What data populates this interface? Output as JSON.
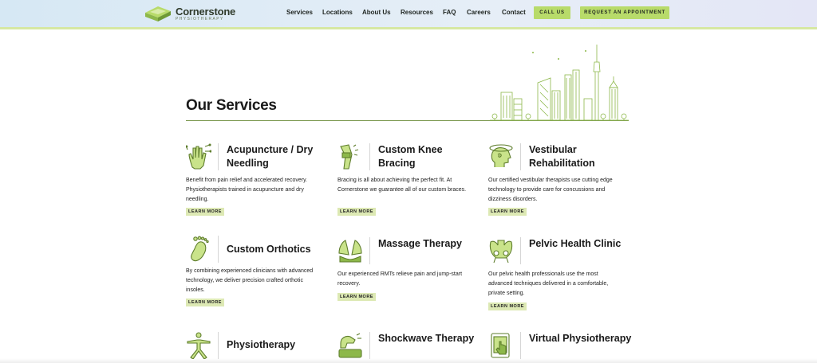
{
  "brand": {
    "name": "Cornerstone",
    "tagline": "PHYSIOTHERAPY",
    "accent_color": "#b8db6a",
    "icon_color": "#8db84a"
  },
  "nav": {
    "items": [
      "Services",
      "Locations",
      "About Us",
      "Resources",
      "FAQ",
      "Careers",
      "Contact"
    ],
    "call_label": "CALL US",
    "appointment_label": "REQUEST AN APPOINTMENT"
  },
  "services": {
    "title": "Our Services",
    "items": [
      {
        "title": "Acupuncture / Dry Needling",
        "icon": "hand-needles-icon",
        "description": "Benefit from pain relief and accelerated recovery. Physiotherapists trained in acupuncture and dry needling.",
        "cta": "LEARN MORE"
      },
      {
        "title": "Custom Knee Bracing",
        "icon": "knee-brace-icon",
        "description": "Bracing is all about achieving the perfect fit. At Cornerstone we guarantee all of our custom braces.",
        "cta": "LEARN MORE"
      },
      {
        "title": "Vestibular Rehabilitation",
        "icon": "head-dizziness-icon",
        "description": "Our certified vestibular therapists use cutting edge technology to provide care for concussions and dizziness disorders.",
        "cta": "LEARN MORE"
      },
      {
        "title": "Custom Orthotics",
        "icon": "foot-icon",
        "description": "By combining experienced clinicians with advanced technology, we deliver precision crafted orthotic insoles.",
        "cta": "LEARN MORE"
      },
      {
        "title": "Massage Therapy",
        "icon": "massage-hands-icon",
        "description": "Our experienced RMTs relieve pain and jump-start recovery.",
        "cta": "LEARN MORE"
      },
      {
        "title": "Pelvic Health Clinic",
        "icon": "pelvis-icon",
        "description": "Our pelvic health professionals use the most advanced techniques delivered in a comfortable, private setting.",
        "cta": "LEARN MORE"
      },
      {
        "title": "Physiotherapy",
        "icon": "yoga-pose-icon"
      },
      {
        "title": "Shockwave Therapy",
        "icon": "shockwave-device-icon"
      },
      {
        "title": "Virtual Physiotherapy",
        "icon": "tablet-touch-icon"
      }
    ]
  }
}
